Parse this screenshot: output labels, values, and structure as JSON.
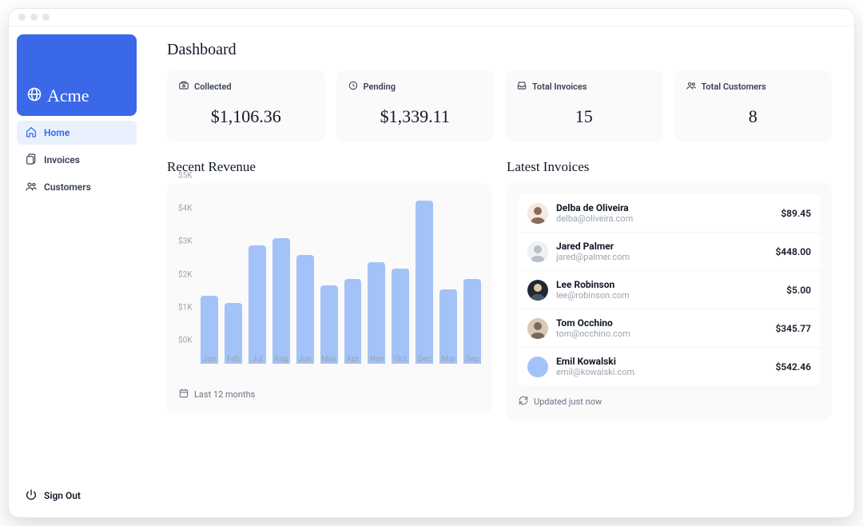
{
  "brand": {
    "name": "Acme"
  },
  "nav": [
    {
      "label": "Home",
      "active": true,
      "icon": "home"
    },
    {
      "label": "Invoices",
      "active": false,
      "icon": "invoices"
    },
    {
      "label": "Customers",
      "active": false,
      "icon": "customers"
    }
  ],
  "signout_label": "Sign Out",
  "page_title": "Dashboard",
  "cards": [
    {
      "label": "Collected",
      "value": "$1,106.36",
      "icon": "collected"
    },
    {
      "label": "Pending",
      "value": "$1,339.11",
      "icon": "clock"
    },
    {
      "label": "Total Invoices",
      "value": "15",
      "icon": "inbox"
    },
    {
      "label": "Total Customers",
      "value": "8",
      "icon": "group"
    }
  ],
  "revenue": {
    "title": "Recent Revenue",
    "footer": "Last 12 months"
  },
  "chart_data": {
    "type": "bar",
    "categories": [
      "Jan",
      "Feb",
      "Jul",
      "Aug",
      "Jun",
      "May",
      "Apr",
      "Nov",
      "Oct",
      "Dec",
      "Mar",
      "Sep"
    ],
    "values": [
      2000,
      1800,
      3500,
      3700,
      3200,
      2300,
      2500,
      3000,
      2800,
      4800,
      2200,
      2500
    ],
    "ylabel": "",
    "xlabel": "",
    "ylim": [
      0,
      5000
    ],
    "yticks": [
      "$0K",
      "$1K",
      "$2K",
      "$3K",
      "$4K",
      "$5K"
    ]
  },
  "invoices": {
    "title": "Latest Invoices",
    "footer": "Updated just now",
    "items": [
      {
        "name": "Delba de Oliveira",
        "email": "delba@oliveira.com",
        "amount": "$89.45",
        "avatar": "f1"
      },
      {
        "name": "Jared Palmer",
        "email": "jared@palmer.com",
        "amount": "$448.00",
        "avatar": "m1"
      },
      {
        "name": "Lee Robinson",
        "email": "lee@robinson.com",
        "amount": "$5.00",
        "avatar": "m2"
      },
      {
        "name": "Tom Occhino",
        "email": "tom@occhino.com",
        "amount": "$345.77",
        "avatar": "m3"
      },
      {
        "name": "Emil Kowalski",
        "email": "emil@kowalski.com",
        "amount": "$542.46",
        "avatar": "blank"
      }
    ]
  }
}
